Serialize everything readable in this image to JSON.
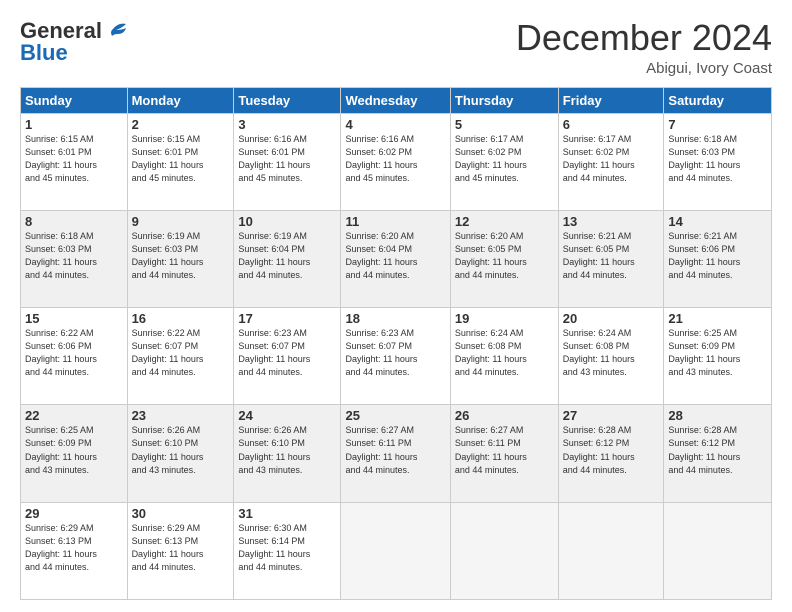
{
  "logo": {
    "general": "General",
    "blue": "Blue"
  },
  "header": {
    "month": "December 2024",
    "location": "Abigui, Ivory Coast"
  },
  "weekdays": [
    "Sunday",
    "Monday",
    "Tuesday",
    "Wednesday",
    "Thursday",
    "Friday",
    "Saturday"
  ],
  "weeks": [
    [
      {
        "day": "1",
        "info": "Sunrise: 6:15 AM\nSunset: 6:01 PM\nDaylight: 11 hours\nand 45 minutes."
      },
      {
        "day": "2",
        "info": "Sunrise: 6:15 AM\nSunset: 6:01 PM\nDaylight: 11 hours\nand 45 minutes."
      },
      {
        "day": "3",
        "info": "Sunrise: 6:16 AM\nSunset: 6:01 PM\nDaylight: 11 hours\nand 45 minutes."
      },
      {
        "day": "4",
        "info": "Sunrise: 6:16 AM\nSunset: 6:02 PM\nDaylight: 11 hours\nand 45 minutes."
      },
      {
        "day": "5",
        "info": "Sunrise: 6:17 AM\nSunset: 6:02 PM\nDaylight: 11 hours\nand 45 minutes."
      },
      {
        "day": "6",
        "info": "Sunrise: 6:17 AM\nSunset: 6:02 PM\nDaylight: 11 hours\nand 44 minutes."
      },
      {
        "day": "7",
        "info": "Sunrise: 6:18 AM\nSunset: 6:03 PM\nDaylight: 11 hours\nand 44 minutes."
      }
    ],
    [
      {
        "day": "8",
        "info": "Sunrise: 6:18 AM\nSunset: 6:03 PM\nDaylight: 11 hours\nand 44 minutes."
      },
      {
        "day": "9",
        "info": "Sunrise: 6:19 AM\nSunset: 6:03 PM\nDaylight: 11 hours\nand 44 minutes."
      },
      {
        "day": "10",
        "info": "Sunrise: 6:19 AM\nSunset: 6:04 PM\nDaylight: 11 hours\nand 44 minutes."
      },
      {
        "day": "11",
        "info": "Sunrise: 6:20 AM\nSunset: 6:04 PM\nDaylight: 11 hours\nand 44 minutes."
      },
      {
        "day": "12",
        "info": "Sunrise: 6:20 AM\nSunset: 6:05 PM\nDaylight: 11 hours\nand 44 minutes."
      },
      {
        "day": "13",
        "info": "Sunrise: 6:21 AM\nSunset: 6:05 PM\nDaylight: 11 hours\nand 44 minutes."
      },
      {
        "day": "14",
        "info": "Sunrise: 6:21 AM\nSunset: 6:06 PM\nDaylight: 11 hours\nand 44 minutes."
      }
    ],
    [
      {
        "day": "15",
        "info": "Sunrise: 6:22 AM\nSunset: 6:06 PM\nDaylight: 11 hours\nand 44 minutes."
      },
      {
        "day": "16",
        "info": "Sunrise: 6:22 AM\nSunset: 6:07 PM\nDaylight: 11 hours\nand 44 minutes."
      },
      {
        "day": "17",
        "info": "Sunrise: 6:23 AM\nSunset: 6:07 PM\nDaylight: 11 hours\nand 44 minutes."
      },
      {
        "day": "18",
        "info": "Sunrise: 6:23 AM\nSunset: 6:07 PM\nDaylight: 11 hours\nand 44 minutes."
      },
      {
        "day": "19",
        "info": "Sunrise: 6:24 AM\nSunset: 6:08 PM\nDaylight: 11 hours\nand 44 minutes."
      },
      {
        "day": "20",
        "info": "Sunrise: 6:24 AM\nSunset: 6:08 PM\nDaylight: 11 hours\nand 43 minutes."
      },
      {
        "day": "21",
        "info": "Sunrise: 6:25 AM\nSunset: 6:09 PM\nDaylight: 11 hours\nand 43 minutes."
      }
    ],
    [
      {
        "day": "22",
        "info": "Sunrise: 6:25 AM\nSunset: 6:09 PM\nDaylight: 11 hours\nand 43 minutes."
      },
      {
        "day": "23",
        "info": "Sunrise: 6:26 AM\nSunset: 6:10 PM\nDaylight: 11 hours\nand 43 minutes."
      },
      {
        "day": "24",
        "info": "Sunrise: 6:26 AM\nSunset: 6:10 PM\nDaylight: 11 hours\nand 43 minutes."
      },
      {
        "day": "25",
        "info": "Sunrise: 6:27 AM\nSunset: 6:11 PM\nDaylight: 11 hours\nand 44 minutes."
      },
      {
        "day": "26",
        "info": "Sunrise: 6:27 AM\nSunset: 6:11 PM\nDaylight: 11 hours\nand 44 minutes."
      },
      {
        "day": "27",
        "info": "Sunrise: 6:28 AM\nSunset: 6:12 PM\nDaylight: 11 hours\nand 44 minutes."
      },
      {
        "day": "28",
        "info": "Sunrise: 6:28 AM\nSunset: 6:12 PM\nDaylight: 11 hours\nand 44 minutes."
      }
    ],
    [
      {
        "day": "29",
        "info": "Sunrise: 6:29 AM\nSunset: 6:13 PM\nDaylight: 11 hours\nand 44 minutes."
      },
      {
        "day": "30",
        "info": "Sunrise: 6:29 AM\nSunset: 6:13 PM\nDaylight: 11 hours\nand 44 minutes."
      },
      {
        "day": "31",
        "info": "Sunrise: 6:30 AM\nSunset: 6:14 PM\nDaylight: 11 hours\nand 44 minutes."
      },
      null,
      null,
      null,
      null
    ]
  ]
}
